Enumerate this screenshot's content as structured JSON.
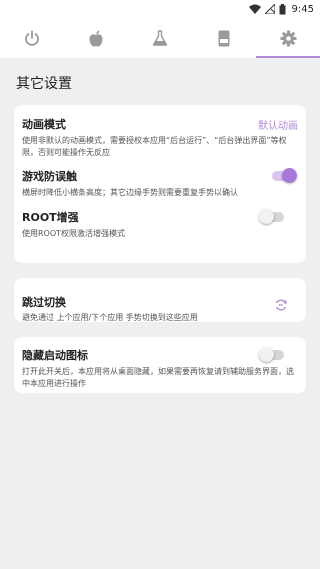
{
  "status_bar": {
    "time": "9:45",
    "icons": [
      "wifi-icon",
      "signal-off-icon",
      "battery-icon"
    ]
  },
  "tabs": [
    {
      "name": "power-icon",
      "active": false
    },
    {
      "name": "apple-icon",
      "active": false
    },
    {
      "name": "flask-icon",
      "active": false
    },
    {
      "name": "phone-icon",
      "active": false
    },
    {
      "name": "gear-icon",
      "active": true
    }
  ],
  "page": {
    "title": "其它设置"
  },
  "animation": {
    "title": "动画模式",
    "value": "默认动画",
    "desc": "使用非默认的动画模式，需要授权本应用“后台运行”、“后台弹出界面”等权限，否则可能操作无反应"
  },
  "anti_mistouch": {
    "title": "游戏防误触",
    "desc": "横屏时降低小横条高度；其它边缘手势则需要重复手势以确认",
    "enabled": true
  },
  "root_boost": {
    "title": "ROOT增强",
    "desc": "使用ROOT权限激活增强模式",
    "enabled": false
  },
  "skip_switch": {
    "title": "跳过切换",
    "desc": "避免通过 上个应用/下个应用 手势切换到这些应用",
    "icon": "skip-forward-icon"
  },
  "hide_launcher": {
    "title": "隐藏启动图标",
    "desc": "打开此开关后，本应用将从桌面隐藏，如果需要再恢复请到辅助服务界面，选中本应用进行操作",
    "enabled": false
  },
  "colors": {
    "accent": "#b089d8",
    "background": "#efefef",
    "card": "#ffffff"
  }
}
